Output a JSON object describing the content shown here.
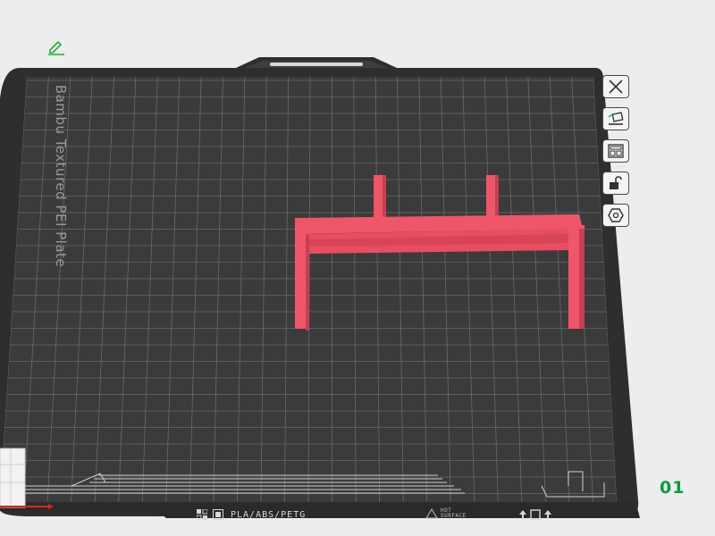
{
  "plate": {
    "name": "Bambu Textured PEI Plate",
    "index_label": "01",
    "filament_label": "PLA/ABS/PETG",
    "hot_surface": [
      "HOT",
      "SURFACE"
    ]
  },
  "toolbar": {
    "buttons": [
      {
        "icon": "close-icon"
      },
      {
        "icon": "paint-plate-icon"
      },
      {
        "icon": "arrange-icon"
      },
      {
        "icon": "unlock-icon"
      },
      {
        "icon": "hexagon-icon"
      }
    ]
  },
  "colors": {
    "background": "#ededed",
    "plate": "#3b3b3b",
    "grid": "#6a6a6a",
    "model": "#f0566a",
    "model_dark": "#c93e52",
    "index_green": "#0a9d3a",
    "edit_green": "#1fae3b"
  }
}
